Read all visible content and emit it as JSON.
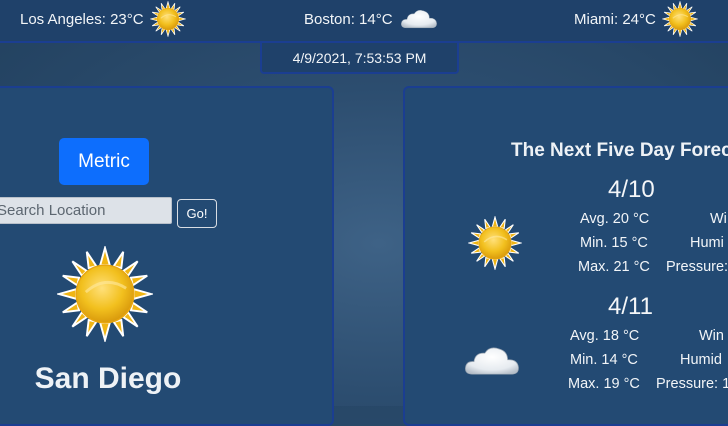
{
  "header": {
    "cities": [
      {
        "label": "Los Angeles: 23°C",
        "icon": "sun-icon"
      },
      {
        "label": "Boston: 14°C",
        "icon": "cloud-icon"
      },
      {
        "label": "Miami: 24°C",
        "icon": "sun-icon"
      }
    ],
    "datetime": "4/9/2021, 7:53:53 PM"
  },
  "left": {
    "units_button": "Metric",
    "search_placeholder": "Search Location",
    "go_button": "Go!",
    "current_icon": "sun-icon",
    "city_name": "San Diego"
  },
  "forecast": {
    "title": "The Next Five Day Forec",
    "days": [
      {
        "date": "4/10",
        "icon": "sun-icon",
        "avg": "Avg. 20 °C",
        "min": "Min. 15 °C",
        "max": "Max. 21 °C",
        "wind": "Wi",
        "humidity": "Humi",
        "pressure": "Pressure:"
      },
      {
        "date": "4/11",
        "icon": "cloud-icon",
        "avg": "Avg. 18 °C",
        "min": "Min. 14 °C",
        "max": "Max. 19 °C",
        "wind": "Win",
        "humidity": "Humid",
        "pressure": "Pressure: 1"
      }
    ]
  },
  "colors": {
    "background": "#2c4d6f",
    "panel": "#234a73",
    "panel_border": "#1b3e91",
    "primary_button": "#0d6efd",
    "sun": "#f2c01e"
  }
}
